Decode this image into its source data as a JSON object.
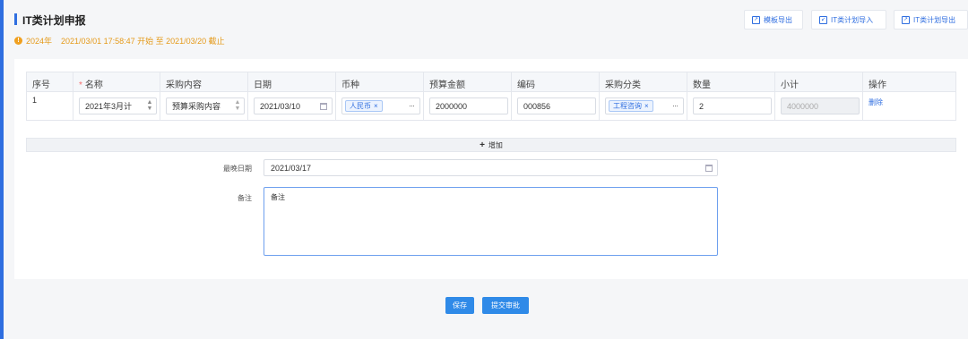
{
  "header": {
    "title": "IT类计划申报",
    "year": "2024年",
    "period": "2021/03/01 17:58:47 开始 至 2021/03/20 截止",
    "buttons": [
      {
        "label": "模板导出",
        "icon": "template-export-icon"
      },
      {
        "label": "IT类计划导入",
        "icon": "import-icon"
      },
      {
        "label": "IT类计划导出",
        "icon": "export-icon"
      }
    ]
  },
  "table": {
    "columns": [
      "序号",
      "名称",
      "采购内容",
      "日期",
      "币种",
      "预算金额",
      "编码",
      "采购分类",
      "数量",
      "小计",
      "操作"
    ],
    "required_mark": "*",
    "rows": [
      {
        "index": "1",
        "name": "2021年3月计",
        "content": "预算采购内容",
        "date": "2021/03/10",
        "currency_tag": "人民币",
        "budget": "2000000",
        "code": "000856",
        "category_tag": "工程咨询",
        "quantity": "2",
        "subtotal": "4000000",
        "action": "删除"
      }
    ]
  },
  "add_label": "增加",
  "form": {
    "latest_date_label": "最晚日期",
    "latest_date_value": "2021/03/17",
    "remark_label": "备注",
    "remark_value": "备注"
  },
  "footer": {
    "save_label": "保存",
    "submit_label": "提交审批"
  },
  "colors": {
    "accent": "#2f6ee0",
    "warning": "#e59a1a",
    "required": "#f56c6c"
  }
}
